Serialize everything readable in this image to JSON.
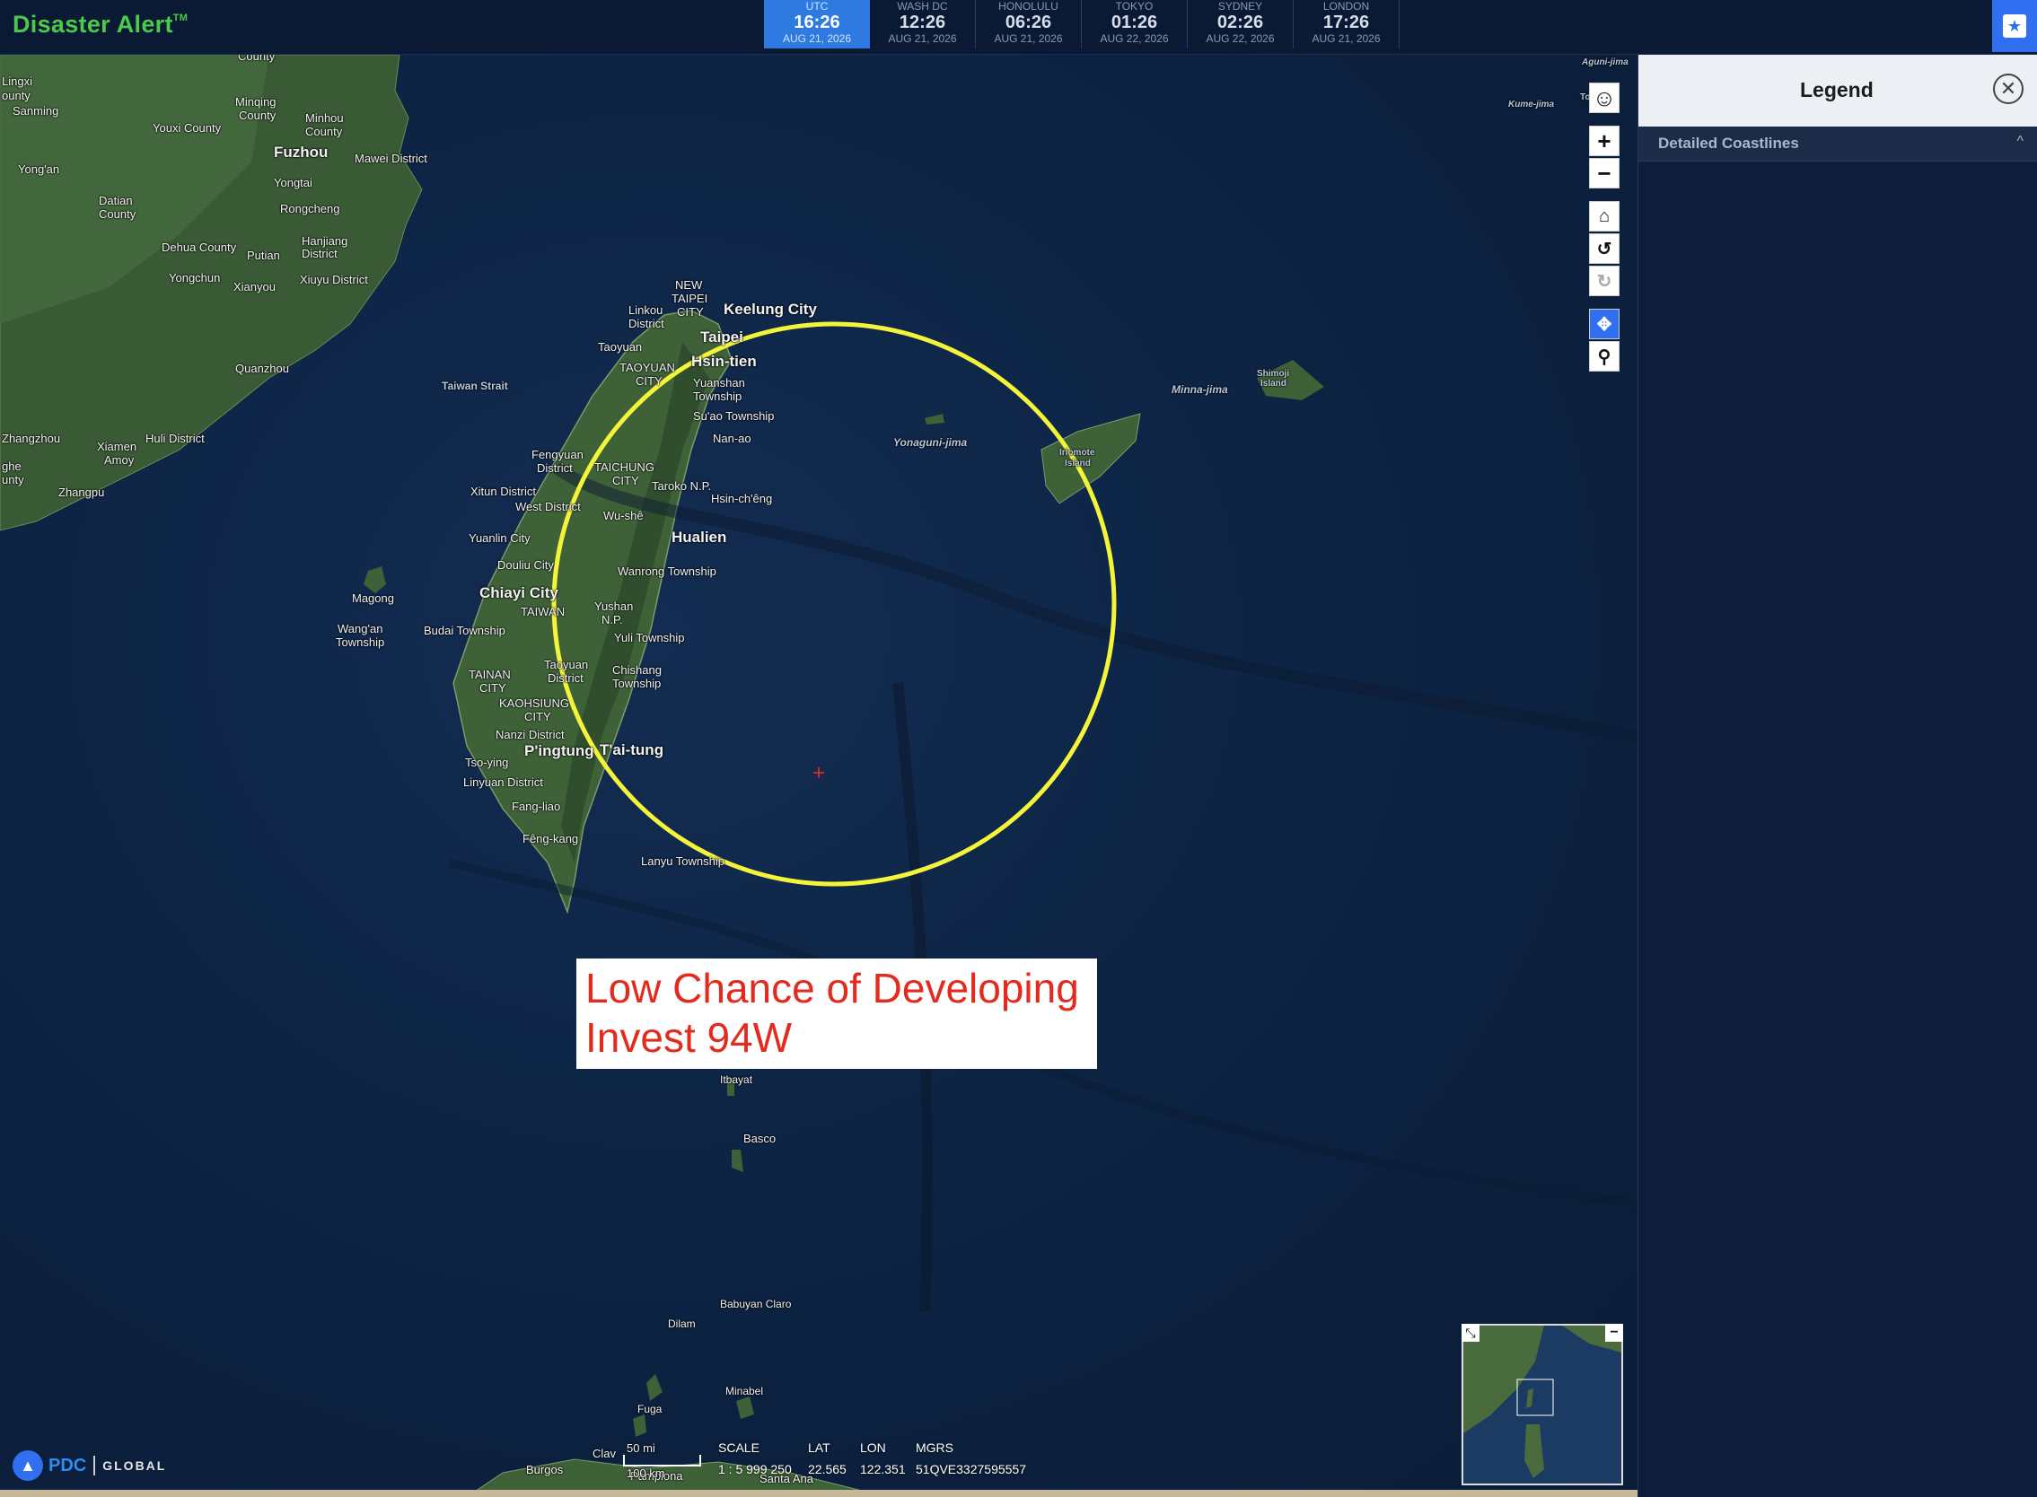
{
  "app": {
    "title": "Disaster Alert",
    "tm": "TM"
  },
  "clocks": [
    {
      "city": "UTC",
      "time": "16:26",
      "date": "AUG 21, 2026",
      "active": true
    },
    {
      "city": "WASH DC",
      "time": "12:26",
      "date": "AUG 21, 2026"
    },
    {
      "city": "HONOLULU",
      "time": "06:26",
      "date": "AUG 21, 2026"
    },
    {
      "city": "TOKYO",
      "time": "01:26",
      "date": "AUG 22, 2026"
    },
    {
      "city": "SYDNEY",
      "time": "02:26",
      "date": "AUG 22, 2026"
    },
    {
      "city": "LONDON",
      "time": "17:26",
      "date": "AUG 21, 2026"
    }
  ],
  "legend": {
    "title": "Legend",
    "close_icon": "close-icon",
    "rows": [
      {
        "label": "Detailed Coastlines",
        "chevron": "^"
      }
    ]
  },
  "callout": {
    "line1": "Low Chance of Developing",
    "line2": "Invest 94W",
    "color": "#e22a1e"
  },
  "circle_color": "#f4f43a",
  "places": {
    "county_top": "County",
    "lingxi": "Lingxi",
    "ounty": "ounty",
    "sanming": "Sanming",
    "minqing": "Minqing",
    "minqing_county": "County",
    "minhou": "Minhou",
    "minhou_county": "County",
    "youxi": "Youxi County",
    "fuzhou": "Fuzhou",
    "mawei": "Mawei District",
    "yongan": "Yong'an",
    "yongtai": "Yongtai",
    "datian": "Datian",
    "datian_county": "County",
    "rongcheng": "Rongcheng",
    "dehua": "Dehua County",
    "putian": "Putian",
    "hanjiang": "Hanjiang",
    "hanjiang_district": "District",
    "yongchun": "Yongchun",
    "xianyou": "Xianyou",
    "xiuyu": "Xiuyu District",
    "quanzhou": "Quanzhou",
    "taiwan_strait": "Taiwan Strait",
    "zhangzhou": "Zhangzhou",
    "xiamen": "Xiamen",
    "amoy": "Amoy",
    "huli": "Huli District",
    "zhangpu": "Zhangpu",
    "ghe": "ghe",
    "unty": "unty",
    "new_taipei": "NEW",
    "taipei_line2": "TAIPEI",
    "taipei_line3": "CITY",
    "linkou": "Linkou",
    "linkou_district": "District",
    "keelung": "Keelung City",
    "taipei": "Taipei",
    "taoyuan": "Taoyuan",
    "taoyuan_city": "TAOYUAN",
    "taoyuan_city2": "CITY",
    "hsintien": "Hsin-tien",
    "yuanshan": "Yuanshan",
    "yuanshan_twp": "Township",
    "suao": "Su'ao Township",
    "nanao": "Nan-ao",
    "fengyuan": "Fengyuan",
    "fengyuan_district": "District",
    "taichung": "TAICHUNG",
    "taichung_city": "CITY",
    "taroko": "Taroko N.P.",
    "xitun": "Xitun District",
    "west": "West District",
    "hsinchang": "Hsin-ch'êng",
    "wushe": "Wu-shê",
    "hualien": "Hualien",
    "yuanlin": "Yuanlin City",
    "douliu": "Douliu City",
    "wanrong": "Wanrong Township",
    "magong": "Magong",
    "chiayi": "Chiayi City",
    "taiwan": "TAIWAN",
    "yushan": "Yushan",
    "yushan_np": "N.P.",
    "wangan": "Wang'an",
    "wangan_twp": "Township",
    "budai": "Budai Township",
    "yuli": "Yuli Township",
    "taoyuan_d": "Taoyuan",
    "taoyuan_d2": "District",
    "chishang": "Chishang",
    "chishang_twp": "Township",
    "tainan": "TAINAN",
    "tainan_city": "CITY",
    "kaohsiung": "KAOHSIUNG",
    "kaohsiung_city": "CITY",
    "nanzi": "Nanzi District",
    "pingtung": "P'ingtung",
    "taitung": "T'ai-tung",
    "tsoying": "Tso-ying",
    "linyuan": "Linyuan District",
    "fangliao": "Fang-liao",
    "fengkang": "Fêng-kang",
    "lanyu": "Lanyu Township",
    "yonaguni": "Yonaguni-jima",
    "iriomote": "Iriomote",
    "iriomote2": "Island",
    "minna": "Minna-jima",
    "shimoji": "Shimoji",
    "shimoji2": "Island",
    "aguni": "Aguni-jima",
    "kume": "Kume-jima",
    "to": "To",
    "itbayat": "Itbayat",
    "basco": "Basco",
    "babuyan": "Babuyan Claro",
    "dilam": "Dilam",
    "minabel": "Minabel",
    "fuga": "Fuga",
    "claveria": "Clav",
    "burgos": "Burgos",
    "pamplona": "Pamplona",
    "santa_ana": "Santa Ana"
  },
  "scale": {
    "mi": "50 mi",
    "km": "100 km"
  },
  "readout": {
    "scale_label": "SCALE",
    "scale_value": "1 : 5 999 250",
    "lat_label": "LAT",
    "lat_value": "22.565",
    "lon_label": "LON",
    "lon_value": "122.351",
    "mgrs_label": "MGRS",
    "mgrs_value": "51QVE3327595557"
  },
  "branding": {
    "pdc": "PDC",
    "global": "GLOBAL"
  },
  "controls": [
    "pegman-icon",
    "zoom-in-icon",
    "zoom-out-icon",
    "home-icon",
    "rotate-left-icon",
    "rotate-right-icon",
    "pan-icon",
    "zoom-box-icon"
  ]
}
